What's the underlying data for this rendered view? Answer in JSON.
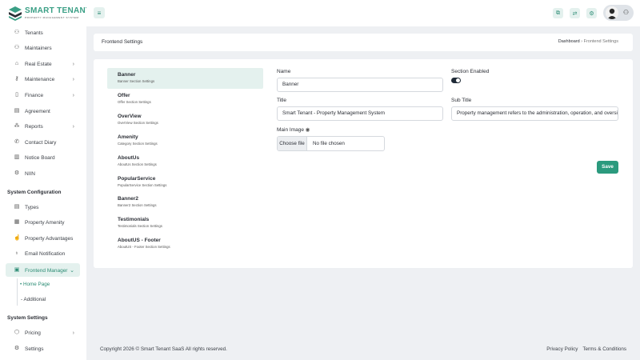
{
  "brand": {
    "title": "SMART TENANT",
    "subtitle": "PROPERTY MANAGEMENT SYSTEM",
    "accent_color": "#2b9a7e"
  },
  "sidebar": {
    "items": [
      {
        "label": "Tenants",
        "icon": "user-icon"
      },
      {
        "label": "Maintainers",
        "icon": "user-plus-icon"
      },
      {
        "label": "Real Estate",
        "icon": "home-icon",
        "has_children": true
      },
      {
        "label": "Maintenance",
        "icon": "key-icon",
        "has_children": true
      },
      {
        "label": "Finance",
        "icon": "file-icon",
        "has_children": true
      },
      {
        "label": "Agreement",
        "icon": "document-icon"
      },
      {
        "label": "Reports",
        "icon": "report-icon",
        "has_children": true
      },
      {
        "label": "Contact Diary",
        "icon": "phone-icon"
      },
      {
        "label": "Notice Board",
        "icon": "board-icon"
      },
      {
        "label": "NIIN",
        "icon": "gear-icon"
      }
    ],
    "section_config": "System Configuration",
    "config_items": [
      {
        "label": "Types",
        "icon": "document-icon"
      },
      {
        "label": "Property Amenity",
        "icon": "grid-icon"
      },
      {
        "label": "Property Advantages",
        "icon": "thumbs-up-icon"
      },
      {
        "label": "Email Notification",
        "icon": "bell-icon"
      },
      {
        "label": "Frontend Manager",
        "icon": "layout-icon",
        "active": true
      }
    ],
    "sub_items": [
      "Home Page",
      "Additional"
    ],
    "section_settings": "System Settings",
    "settings_items": [
      {
        "label": "Pricing",
        "icon": "box-icon",
        "has_children": true
      },
      {
        "label": "Settings",
        "icon": "gear-icon"
      }
    ]
  },
  "header": {
    "page_title": "Frontend Settings",
    "breadcrumb_root": "Dashboard",
    "breadcrumb_sep": "›",
    "breadcrumb_current": "Frontend Settings"
  },
  "tabs": [
    {
      "title": "Banner",
      "sub": "Banner Section Settings"
    },
    {
      "title": "Offer",
      "sub": "Offer Section Settings"
    },
    {
      "title": "OverView",
      "sub": "OverView Section Settings"
    },
    {
      "title": "Amenity",
      "sub": "Category Section Settings"
    },
    {
      "title": "AboutUs",
      "sub": "AboutUs Section Settings"
    },
    {
      "title": "PopularService",
      "sub": "PopularService Section Settings"
    },
    {
      "title": "Banner2",
      "sub": "Banner2 Section Settings"
    },
    {
      "title": "Testimonials",
      "sub": "Testimonials Section Settings"
    },
    {
      "title": "AboutUS - Footer",
      "sub": "AboutUS - Footer Section Settings"
    }
  ],
  "form": {
    "name_label": "Name",
    "name_value": "Banner",
    "section_enabled_label": "Section Enabled",
    "section_enabled": true,
    "title_label": "Title",
    "title_value": "Smart Tenant - Property Management System",
    "subtitle_label": "Sub Title",
    "subtitle_value": "Property management refers to the administration, operation, and oversight of real estate",
    "image_label": "Main Image",
    "file_button": "Choose file",
    "file_status": "No file chosen",
    "save_label": "Save"
  },
  "footer": {
    "copyright": "Copyright 2026 © Smart Tenant SaaS All rights reserved.",
    "privacy": "Privacy Policy",
    "terms": "Terms & Conditions"
  }
}
